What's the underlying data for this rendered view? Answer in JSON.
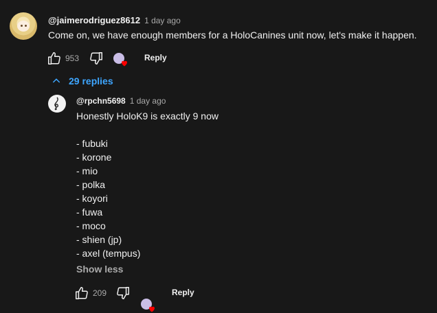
{
  "comment": {
    "author": "@jaimerodriguez8612",
    "time": "1 day ago",
    "text": "Come on, we have enough members for a HoloCanines unit now, let's make it happen.",
    "likes": "953",
    "reply_label": "Reply",
    "replies_label": "29 replies"
  },
  "reply": {
    "author": "@rpchn5698",
    "time": "1 day ago",
    "text_first": "Honestly HoloK9 is exactly 9 now",
    "list": [
      "- fubuki",
      "- korone",
      "- mio",
      "- polka",
      "- koyori",
      "- fuwa",
      "- moco",
      "- shien (jp)",
      "- axel (tempus)"
    ],
    "show_less": "Show less",
    "likes": "209",
    "reply_label": "Reply"
  },
  "colors": {
    "background": "#181818",
    "link": "#3ea6ff",
    "heart": "#ff0000"
  }
}
